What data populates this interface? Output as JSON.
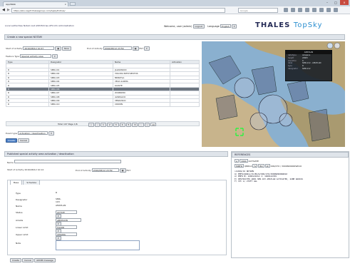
{
  "browser": {
    "tab_title": "AppliWeb",
    "url": "https://sbv.cegrfr.thalesgroup.com/ApplyEntries/",
    "search_placeholder": "Google"
  },
  "header": {
    "links": "Local authorities  Notam List  ASM Entries  ATS Info  Administration",
    "welcome": "Welcome, user (admin)",
    "logout": "Logout",
    "language_label": "Language",
    "language_value": "English",
    "logo_main": "THALES ",
    "logo_sky": "TopSky"
  },
  "create_panel": {
    "title": "Create a new special NOTAM",
    "start_label": "Start of Activity",
    "start_value": "2016/08/12 10:47",
    "now_button": "Now",
    "end_label": "End of Activity",
    "end_value": "2016/08/12 23:59",
    "utc": "EST",
    "feature_type_label": "Feature Type",
    "feature_type_value": "Special activity area",
    "columns": [
      "Type",
      "Designator",
      "Name",
      "Activation"
    ],
    "rows": [
      {
        "type": "R",
        "designator": "SMR-101",
        "name": "JALIKKSKOO",
        "act": ""
      },
      {
        "type": "R",
        "designator": "SMR-102",
        "name": "VOLODA PATCH-BISTOS",
        "act": ""
      },
      {
        "type": "R",
        "designator": "SMR-103",
        "name": "BRISKTLA",
        "act": ""
      },
      {
        "type": "R",
        "designator": "SMR-104",
        "name": "VELO ALKIMA",
        "act": ""
      },
      {
        "type": "R",
        "designator": "SMR-105",
        "name": "KASSTE",
        "act": ""
      },
      {
        "type": "R",
        "designator": "SMR-106",
        "name": "",
        "act": ""
      },
      {
        "type": "R",
        "designator": "SMR-107",
        "name": "ZUOBOMO",
        "act": ""
      },
      {
        "type": "R",
        "designator": "SMR-108",
        "name": "AVARSACO",
        "act": ""
      },
      {
        "type": "R",
        "designator": "SMR-109",
        "name": "VERAOSCO",
        "act": ""
      },
      {
        "type": "R",
        "designator": "SMR-110",
        "name": "CROWN",
        "act": ""
      }
    ],
    "selected_row": 5,
    "pager_total": "Total 107 Page 1/6",
    "pages": [
      "1",
      "2",
      "3",
      "4",
      "5",
      "6"
    ],
    "page_size": "20",
    "event_type_label": "Event type",
    "event_type_value": "Activation / deactivation",
    "create_button": "Create",
    "cancel_button": "Cancel"
  },
  "map": {
    "info_title": "AMATLAN",
    "info_rows": [
      {
        "k": "dataType",
        "v": "Airspace"
      },
      {
        "k": "height",
        "v": "22NM"
      },
      {
        "k": "elevation",
        "v": "0"
      },
      {
        "k": "label",
        "v": "SMR-112 - AMATLAN"
      },
      {
        "k": "type",
        "v": "R"
      },
      {
        "k": "designator",
        "v": "SMR-112"
      }
    ]
  },
  "published_panel": {
    "title": "Published special activity area activation / deactivation",
    "name_label": "Name",
    "start_label": "Start of Activity",
    "start_value": "2016/08/12 10:14",
    "end_label": "End of Activity",
    "end_value": "2016/08/12 23:59",
    "utc": "EST",
    "tabs": [
      "Base",
      "Schedule"
    ],
    "fields": [
      {
        "k": "Type",
        "v": "R"
      },
      {
        "k": "Designator",
        "v": "SMR-103"
      },
      {
        "k": "Name",
        "v": "AMATLAN"
      },
      {
        "k": "Status",
        "v": "ACTIVE"
      },
      {
        "k": "Airside",
        "v": "ABSHAON"
      },
      {
        "k": "Lower Limit",
        "v": "FLOOR"
      },
      {
        "k": "Upper Limit",
        "v": "CEILING"
      },
      {
        "k": "Note",
        "v": ""
      }
    ],
    "create_button": "Create",
    "cancel_button": "Cancel",
    "addm_button": "ADDM message"
  },
  "notam": {
    "title": "REFERENCES",
    "id_prefix": "A",
    "id_number": "1604",
    "id_suffix": "ACTIVATE",
    "qline_fir": "MMFR",
    "qline_code": "QRRCA",
    "qline_1": "IV",
    "qline_2": "BO",
    "qline_3": "W",
    "qline_tail": "000/270 / 3000N09900W010",
    "text": "(A1604/16 NOTAMN\nQ) MMFR/QRRCA/IV/BO/W/000/270/3000N09900W010\nA) MMFR B) 1608121014 C) 1608122359\nE) RESTRICTED AREA SMR-103 AMATLAN ACTIVATED, 22NM RADIUS\nF) SFC G) 270FT AGL"
  }
}
